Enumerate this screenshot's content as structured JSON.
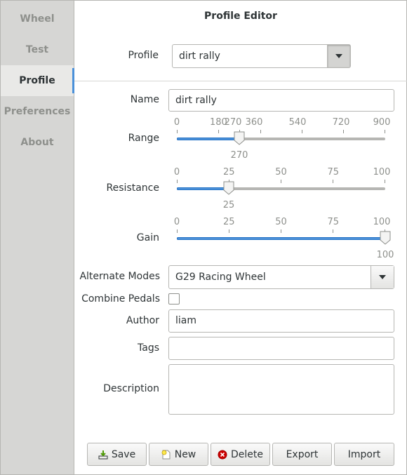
{
  "sidebar": {
    "items": [
      {
        "label": "Wheel",
        "active": false
      },
      {
        "label": "Test",
        "active": false
      },
      {
        "label": "Profile",
        "active": true
      },
      {
        "label": "Preferences",
        "active": false
      },
      {
        "label": "About",
        "active": false
      }
    ]
  },
  "header": {
    "title": "Profile Editor"
  },
  "profile": {
    "label": "Profile",
    "selected": "dirt rally"
  },
  "form": {
    "name": {
      "label": "Name",
      "value": "dirt rally"
    },
    "range": {
      "label": "Range",
      "ticks": [
        "0",
        "180",
        "270",
        "360",
        "540",
        "720",
        "900"
      ],
      "min": 0,
      "max": 900,
      "value": 270,
      "value_text": "270"
    },
    "resistance": {
      "label": "Resistance",
      "ticks": [
        "0",
        "25",
        "50",
        "75",
        "100"
      ],
      "min": 0,
      "max": 100,
      "value": 25,
      "value_text": "25"
    },
    "gain": {
      "label": "Gain",
      "ticks": [
        "0",
        "25",
        "50",
        "75",
        "100"
      ],
      "min": 0,
      "max": 100,
      "value": 100,
      "value_text": "100"
    },
    "alternate_modes": {
      "label": "Alternate Modes",
      "selected": "G29 Racing Wheel"
    },
    "combine_pedals": {
      "label": "Combine Pedals",
      "checked": false
    },
    "author": {
      "label": "Author",
      "value": "liam"
    },
    "tags": {
      "label": "Tags",
      "value": ""
    },
    "description": {
      "label": "Description",
      "value": ""
    }
  },
  "buttons": {
    "save": {
      "label": "Save",
      "icon": "save-icon"
    },
    "new": {
      "label": "New",
      "icon": "new-document-icon"
    },
    "delete": {
      "label": "Delete",
      "icon": "delete-icon"
    },
    "export": {
      "label": "Export"
    },
    "import": {
      "label": "Import"
    }
  },
  "colors": {
    "accent": "#4a90d9",
    "sidebar_bg": "#d6d6d4",
    "delete_red": "#cc0000",
    "save_green": "#4e9a06"
  }
}
